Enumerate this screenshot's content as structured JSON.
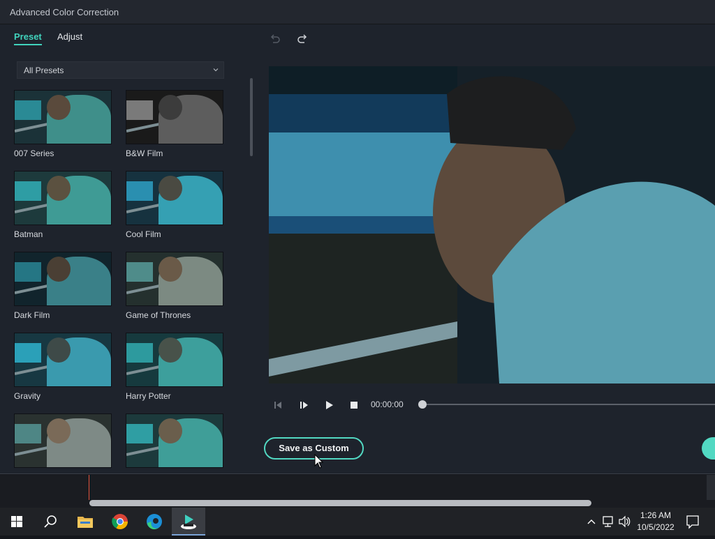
{
  "window": {
    "title": "Advanced Color Correction"
  },
  "tabs": [
    {
      "label": "Preset",
      "active": true
    },
    {
      "label": "Adjust",
      "active": false
    }
  ],
  "filter": {
    "selected": "All Presets"
  },
  "presets": [
    {
      "name": "007 Series"
    },
    {
      "name": "B&W Film"
    },
    {
      "name": "Batman"
    },
    {
      "name": "Cool Film"
    },
    {
      "name": "Dark Film"
    },
    {
      "name": "Game of Thrones"
    },
    {
      "name": "Gravity"
    },
    {
      "name": "Harry Potter"
    },
    {
      "name": ""
    },
    {
      "name": ""
    }
  ],
  "playback": {
    "timecode": "00:00:00",
    "progress": 0
  },
  "actions": {
    "save_custom_label": "Save as Custom"
  },
  "taskbar": {
    "time": "1:26 AM",
    "date": "10/5/2022"
  },
  "colors": {
    "accent": "#41d3bd",
    "button_border": "#52d8c2",
    "background": "#1e232c"
  }
}
